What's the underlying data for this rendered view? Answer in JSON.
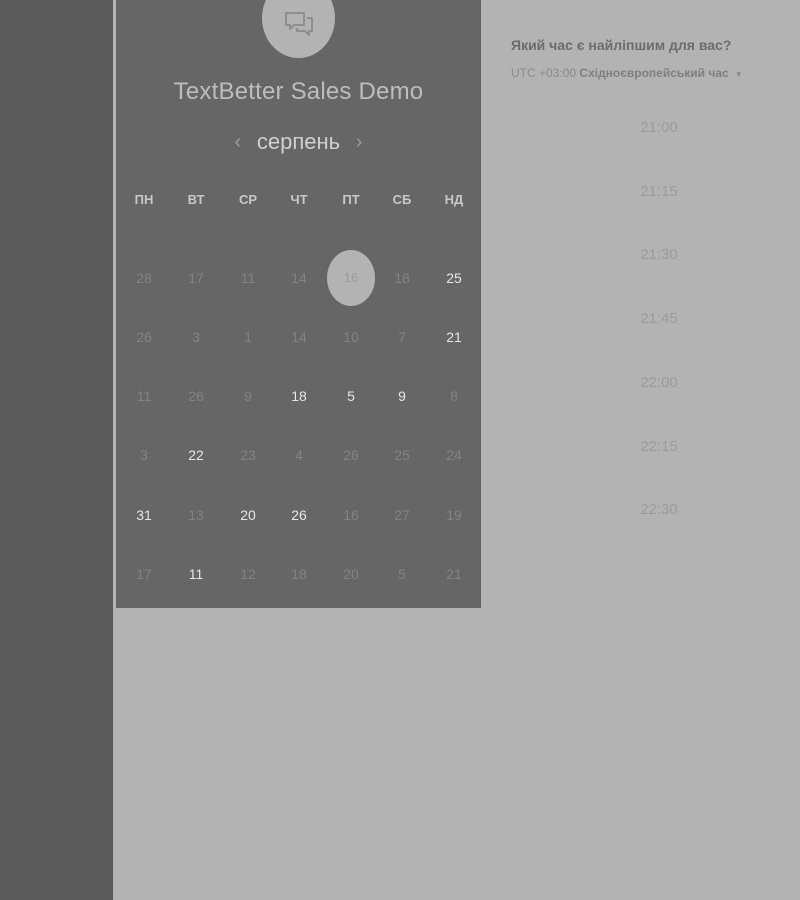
{
  "calendar": {
    "logo_icon": "chat-bubbles-icon",
    "title": "TextBetter Sales Demo",
    "month": "серпень",
    "prev_icon": "chevron-left-icon",
    "next_icon": "chevron-right-icon",
    "prev_arrow": "‹",
    "next_arrow": "›",
    "weekdays": [
      "ПН",
      "ВТ",
      "СР",
      "ЧТ",
      "ПТ",
      "СБ",
      "НД"
    ],
    "weeks": [
      [
        {
          "d": "28",
          "a": false
        },
        {
          "d": "17",
          "a": false
        },
        {
          "d": "11",
          "a": false
        },
        {
          "d": "14",
          "a": false
        },
        {
          "d": "16",
          "a": false,
          "selected": true
        },
        {
          "d": "18",
          "a": false
        },
        {
          "d": "25",
          "a": true
        }
      ],
      [
        {
          "d": "26",
          "a": false
        },
        {
          "d": "3",
          "a": false
        },
        {
          "d": "1",
          "a": false
        },
        {
          "d": "14",
          "a": false
        },
        {
          "d": "10",
          "a": false
        },
        {
          "d": "7",
          "a": false
        },
        {
          "d": "21",
          "a": true
        }
      ],
      [
        {
          "d": "11",
          "a": false
        },
        {
          "d": "26",
          "a": false
        },
        {
          "d": "9",
          "a": false
        },
        {
          "d": "18",
          "a": true
        },
        {
          "d": "5",
          "a": true
        },
        {
          "d": "9",
          "a": true
        },
        {
          "d": "8",
          "a": false
        }
      ],
      [
        {
          "d": "3",
          "a": false
        },
        {
          "d": "22",
          "a": true
        },
        {
          "d": "23",
          "a": false
        },
        {
          "d": "4",
          "a": false
        },
        {
          "d": "26",
          "a": false
        },
        {
          "d": "25",
          "a": false
        },
        {
          "d": "24",
          "a": false
        }
      ],
      [
        {
          "d": "31",
          "a": true
        },
        {
          "d": "13",
          "a": false
        },
        {
          "d": "20",
          "a": true
        },
        {
          "d": "26",
          "a": true
        },
        {
          "d": "16",
          "a": false
        },
        {
          "d": "27",
          "a": false
        },
        {
          "d": "19",
          "a": false
        }
      ],
      [
        {
          "d": "17",
          "a": false
        },
        {
          "d": "11",
          "a": true
        },
        {
          "d": "12",
          "a": false
        },
        {
          "d": "18",
          "a": false
        },
        {
          "d": "20",
          "a": false
        },
        {
          "d": "5",
          "a": false
        },
        {
          "d": "21",
          "a": false
        }
      ]
    ]
  },
  "times": {
    "question": "Який час є найліпшим для вас?",
    "tz_offset": "UTC +03:00",
    "tz_name": "Східноєвропейський час",
    "tz_caret": "▼",
    "slots": [
      "21:00",
      "21:15",
      "21:30",
      "21:45",
      "22:00",
      "22:15",
      "22:30"
    ]
  }
}
